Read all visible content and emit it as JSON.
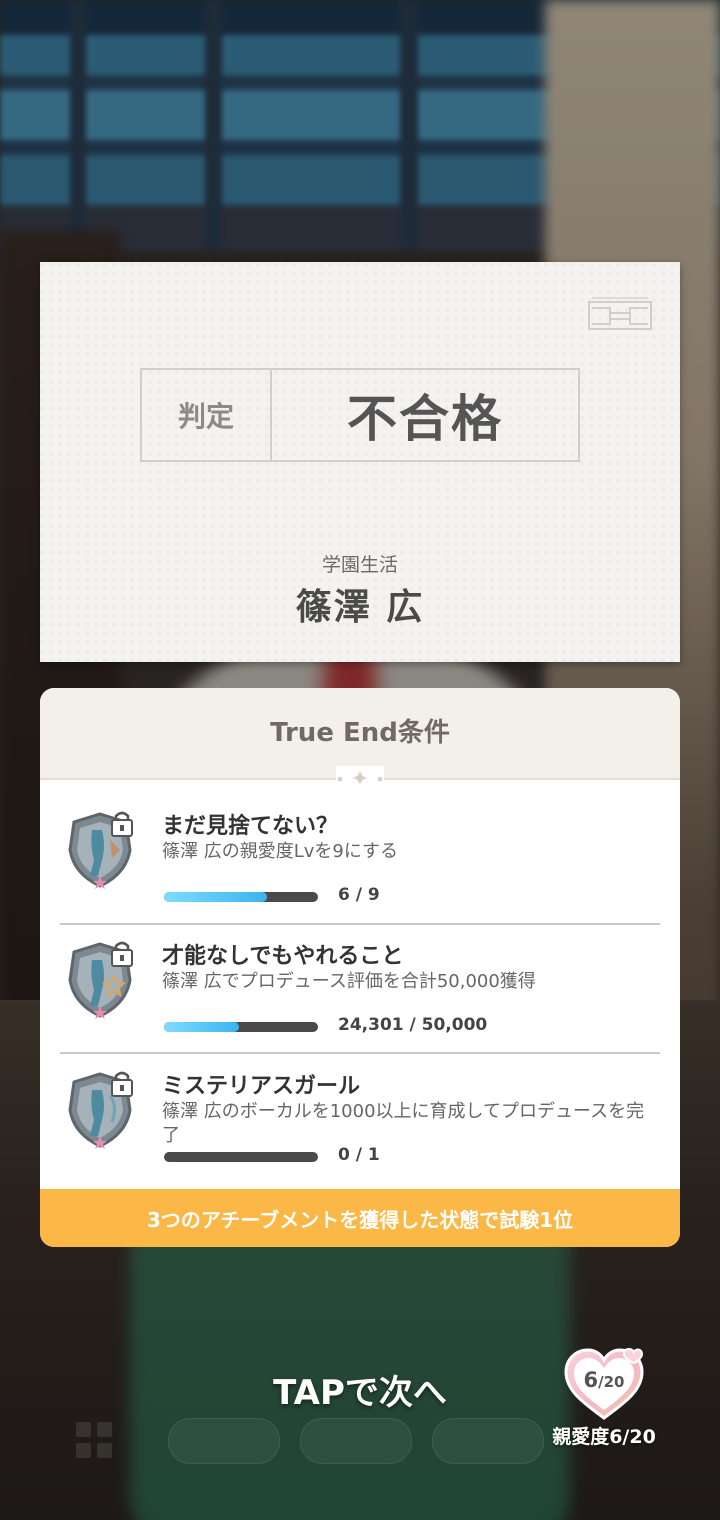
{
  "result": {
    "verdict_label": "判定",
    "verdict_value": "不合格",
    "subject": "学園生活",
    "idol_name": "篠澤 広"
  },
  "true_end": {
    "title": "True End条件",
    "achievements": [
      {
        "title": "まだ見捨てない？",
        "description": "篠澤 広の親愛度Lvを9にする",
        "progress_text": "6 / 9",
        "progress_fraction": 0.667
      },
      {
        "title": "才能なしでもやれること",
        "description": "篠澤 広でプロデュース評価を合計50,000獲得",
        "progress_text": "24,301 / 50,000",
        "progress_fraction": 0.486
      },
      {
        "title": "ミステリアスガール",
        "description": "篠澤 広のボーカルを1000以上に育成してプロデュースを完了",
        "progress_text": "0 / 1",
        "progress_fraction": 0
      }
    ],
    "footer": "3つのアチーブメントを獲得した状態で試験1位"
  },
  "bottom": {
    "tap_next": "TAPで次へ",
    "affection_value": "6",
    "affection_max": "/20",
    "affection_label": "親愛度6/20"
  },
  "colors": {
    "progress_fill": "#3ab3f0",
    "footer_bg": "#fbb846",
    "affection_heart": "#f6b9c9"
  },
  "icons": [
    "stamp-icon",
    "achievement-badge-icon",
    "lock-icon",
    "sparkle-icon",
    "heart-icon"
  ]
}
